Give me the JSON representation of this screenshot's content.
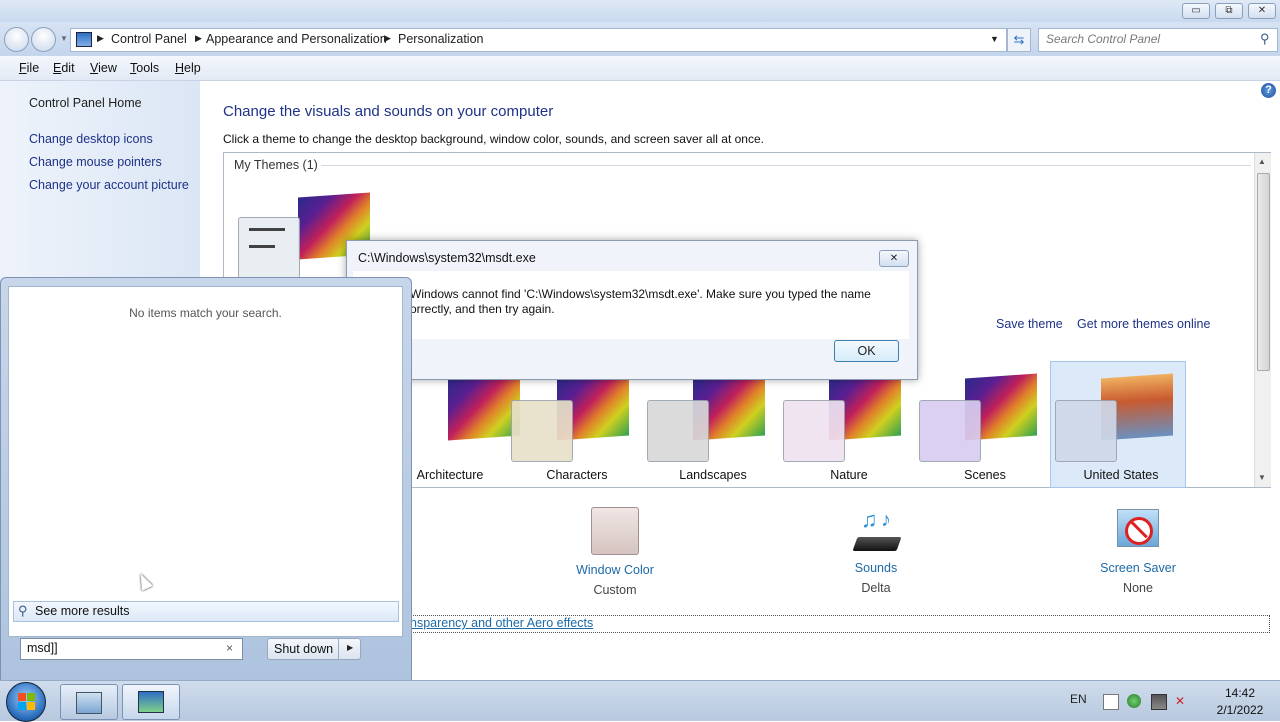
{
  "window": {
    "minimize_glyph": "▭",
    "maximize_glyph": "⧉",
    "close_glyph": "✕"
  },
  "address": {
    "breadcrumbs": [
      "Control Panel",
      "Appearance and Personalization",
      "Personalization"
    ],
    "search_placeholder": "Search Control Panel"
  },
  "menu": [
    "File",
    "Edit",
    "View",
    "Tools",
    "Help"
  ],
  "sidebar": {
    "home": "Control Panel Home",
    "links": [
      "Change desktop icons",
      "Change mouse pointers",
      "Change your account picture"
    ]
  },
  "main": {
    "heading": "Change the visuals and sounds on your computer",
    "subtext": "Click a theme to change the desktop background, window color, sounds, and screen saver all at once.",
    "my_themes": "My Themes (1)",
    "save_theme": "Save theme",
    "get_more": "Get more themes online",
    "themes": [
      {
        "label": "Architecture",
        "tint": "#5a8fd0"
      },
      {
        "label": "Characters",
        "tint": "#e8e0c8"
      },
      {
        "label": "Landscapes",
        "tint": "#d8d8d8"
      },
      {
        "label": "Nature",
        "tint": "#efe2f0"
      },
      {
        "label": "Scenes",
        "tint": "#d9cdf0"
      },
      {
        "label": "United States",
        "tint": "#cfd8e8"
      }
    ],
    "bottom": [
      {
        "title": "Window Color",
        "sub": "Custom"
      },
      {
        "title": "Sounds",
        "sub": "Delta"
      },
      {
        "title": "Screen Saver",
        "sub": "None"
      }
    ],
    "aero_link": "nsparency and other Aero effects"
  },
  "dialog": {
    "title": "C:\\Windows\\system32\\msdt.exe",
    "line1": "Windows cannot find 'C:\\Windows\\system32\\msdt.exe'. Make sure you typed the name",
    "line2": "orrectly, and then try again.",
    "ok": "OK"
  },
  "startmenu": {
    "no_items": "No items match your search.",
    "see_more": "See more results",
    "search_value": "msd]]",
    "shutdown": "Shut down"
  },
  "taskbar": {
    "lang": "EN",
    "time": "14:42",
    "date": "2/1/2022"
  }
}
